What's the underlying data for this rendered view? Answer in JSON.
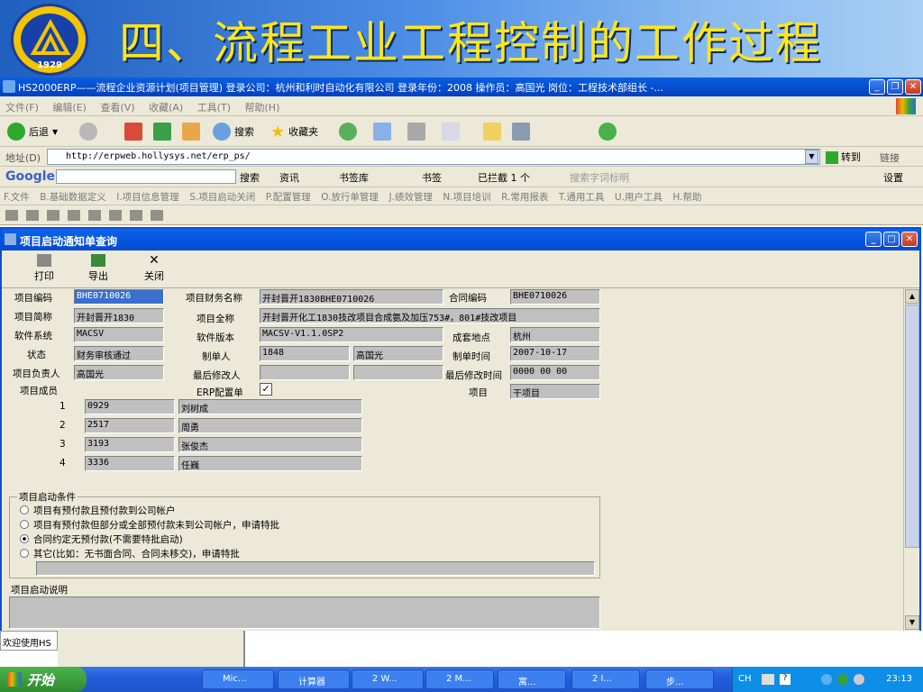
{
  "slide": {
    "title": "四、流程工业工程控制的工作过程",
    "logo_year": "1929"
  },
  "ie": {
    "title": "HS2000ERP——流程企业资源计划(项目管理) 登录公司：杭州和利时自动化有限公司 登录年份：2008 操作员：高国光 岗位：工程技术部组长 -...",
    "menu": [
      "文件(F)",
      "编辑(E)",
      "查看(V)",
      "收藏(A)",
      "工具(T)",
      "帮助(H)"
    ],
    "toolbar": {
      "back": "后退",
      "search": "搜索",
      "favorites": "收藏夹"
    },
    "address": {
      "label": "地址(D)",
      "url": "http://erpweb.hollysys.net/erp_ps/",
      "go": "转到",
      "links": "链接"
    },
    "google": {
      "brand": "Google",
      "search": "搜索",
      "info": "资讯",
      "bookmarks_lib": "书签库",
      "bookmarks": "书签",
      "blocked": "已拦截 1 个",
      "spell": "搜索字词标明",
      "settings": "设置"
    },
    "erp_menu": [
      "F.文件",
      "B.基础数据定义",
      "I.项目信息管理",
      "S.项目启动关闭",
      "P.配置管理",
      "O.放行单管理",
      "J.绩效管理",
      "N.项目培训",
      "R.常用报表",
      "T.通用工具",
      "U.用户工具",
      "H.帮助"
    ]
  },
  "window": {
    "title": "项目启动通知单查询",
    "toolbar": {
      "print": "打印",
      "export": "导出",
      "close": "关闭"
    }
  },
  "form": {
    "labels": {
      "code": "项目编码",
      "finance_name": "项目财务名称",
      "contract_code": "合同编码",
      "short_name": "项目简称",
      "full_name": "项目全称",
      "software": "软件系统",
      "version": "软件版本",
      "location": "成套地点",
      "status": "状态",
      "creator": "制单人",
      "create_time": "制单时间",
      "owner": "项目负责人",
      "modifier": "最后修改人",
      "modify_time": "最后修改时间",
      "members": "项目成员",
      "erp_config": "ERP配置单",
      "project": "项目"
    },
    "values": {
      "code": "BHE0710026",
      "finance_name": "开封晋开1830BHE0710026",
      "contract_code": "BHE0710026",
      "short_name": "开封晋开1830",
      "full_name": "开封晋开化工1830技改项目合成氨及加压753#，801#技改项目",
      "software": "MACSV",
      "version": "MACSV-V1.1.0SP2",
      "location": "杭州",
      "status": "财务审核通过",
      "creator_id": "1848",
      "creator_name": "高国光",
      "create_time": "2007-10-17",
      "owner": "高国光",
      "modifier_id": "",
      "modifier_name": "",
      "modify_time": "0000 00 00",
      "project": "干项目"
    },
    "members": [
      {
        "no": "1",
        "id": "0929",
        "name": "刘树成"
      },
      {
        "no": "2",
        "id": "2517",
        "name": "周勇"
      },
      {
        "no": "3",
        "id": "3193",
        "name": "张俊杰"
      },
      {
        "no": "4",
        "id": "3336",
        "name": "任巍"
      }
    ],
    "conditions": {
      "legend": "项目启动条件",
      "options": [
        "项目有预付款且预付款到公司帐户",
        "项目有预付款但部分或全部预付款未到公司帐户，申请特批",
        "合同约定无预付款(不需要特批启动)",
        "其它(比如：无书面合同、合同未移交)，申请特批"
      ],
      "selected": 2
    },
    "desc_label": "项目启动说明"
  },
  "status_text": "欢迎使用HS",
  "taskbar": {
    "start": "开始",
    "tasks": [
      "Mic...",
      "计算器",
      "2 W...",
      "2 M...",
      "寓...",
      "2 I...",
      "步..."
    ],
    "lang": "CH",
    "clock": "23:13"
  },
  "colors": {
    "banner_title": "#ffe61a",
    "xp_blue": "#0a5ee0",
    "form_bg": "#ece9d8"
  }
}
